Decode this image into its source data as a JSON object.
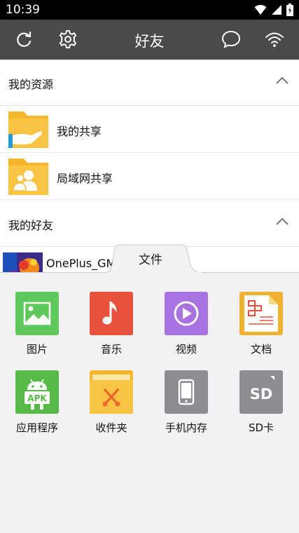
{
  "status_bar": {
    "time": "10:39"
  },
  "header": {
    "title": "好友"
  },
  "sections": {
    "resources": {
      "label": "我的资源"
    },
    "friends": {
      "label": "我的好友"
    }
  },
  "resources": [
    {
      "label": "我的共享"
    },
    {
      "label": "局域网共享"
    }
  ],
  "friends": [
    {
      "name": "OnePlus_GM"
    }
  ],
  "file_panel": {
    "tab_label": "文件",
    "items": [
      {
        "label": "图片",
        "icon": "image-icon"
      },
      {
        "label": "音乐",
        "icon": "music-icon"
      },
      {
        "label": "视频",
        "icon": "video-icon"
      },
      {
        "label": "文档",
        "icon": "document-icon"
      },
      {
        "label": "应用程序",
        "icon": "apk-icon"
      },
      {
        "label": "收件夹",
        "icon": "inbox-folder-icon"
      },
      {
        "label": "手机内存",
        "icon": "phone-icon"
      },
      {
        "label": "SD卡",
        "icon": "sd-card-icon"
      }
    ]
  },
  "colors": {
    "header_bg": "#4a4a4c",
    "folder_yellow": "#f6b62b",
    "image_green": "#5fc85a",
    "music_red": "#e8523c",
    "video_purple": "#a872e0",
    "doc_orange": "#f0b030",
    "apk_green": "#57b947",
    "phone_gray": "#8c8d93"
  }
}
